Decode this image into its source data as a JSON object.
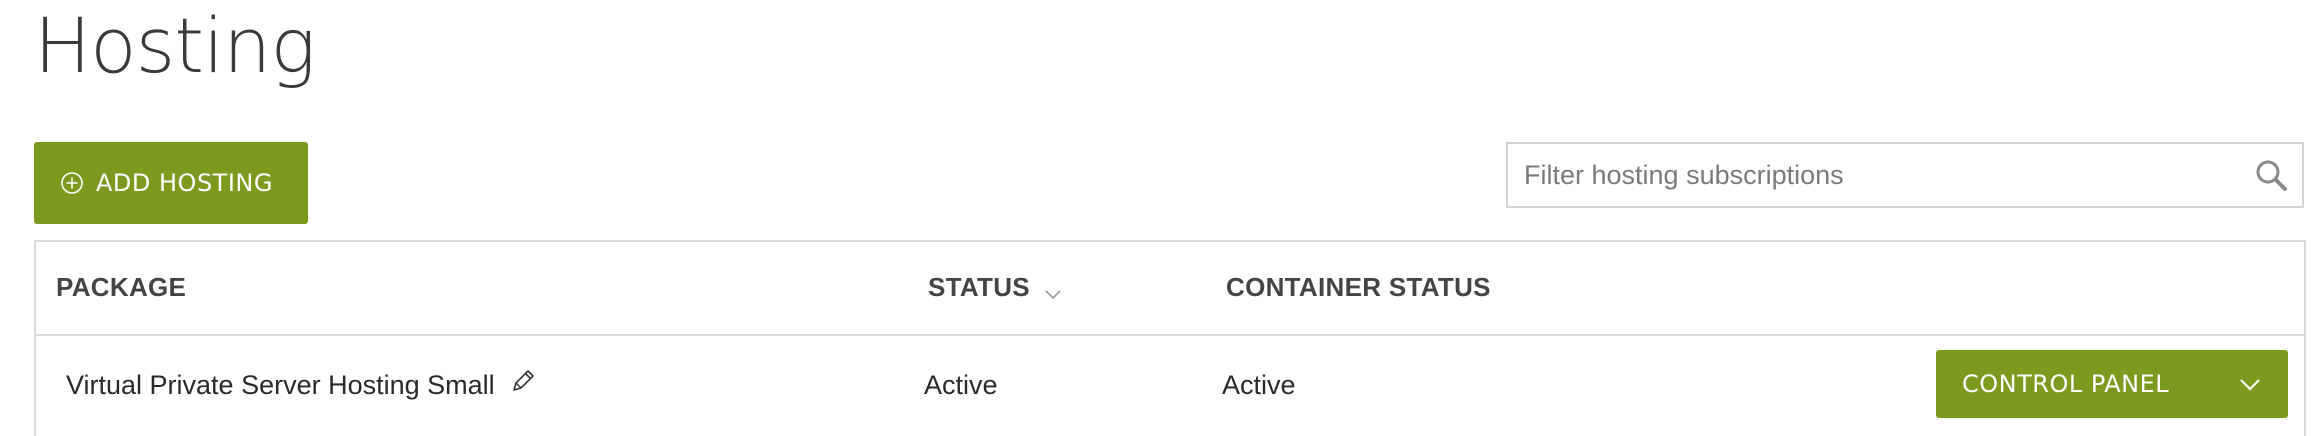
{
  "page": {
    "title": "Hosting"
  },
  "toolbar": {
    "add_label": "ADD HOSTING",
    "filter_placeholder": "Filter hosting subscriptions",
    "filter_value": ""
  },
  "table": {
    "columns": [
      {
        "label": "PACKAGE"
      },
      {
        "label": "STATUS"
      },
      {
        "label": "CONTAINER STATUS"
      }
    ],
    "rows": [
      {
        "package": "Virtual Private Server Hosting Small",
        "status": "Active",
        "container_status": "Active",
        "action_label": "CONTROL PANEL"
      }
    ]
  },
  "icons": {
    "add": "plus-circle-icon",
    "search": "search-icon",
    "sort": "chevron-down-icon",
    "edit": "pencil-icon",
    "dropdown": "chevron-down-icon"
  },
  "colors": {
    "accent": "#7b9a1e",
    "border": "#d9d9d9",
    "text": "#333333"
  }
}
